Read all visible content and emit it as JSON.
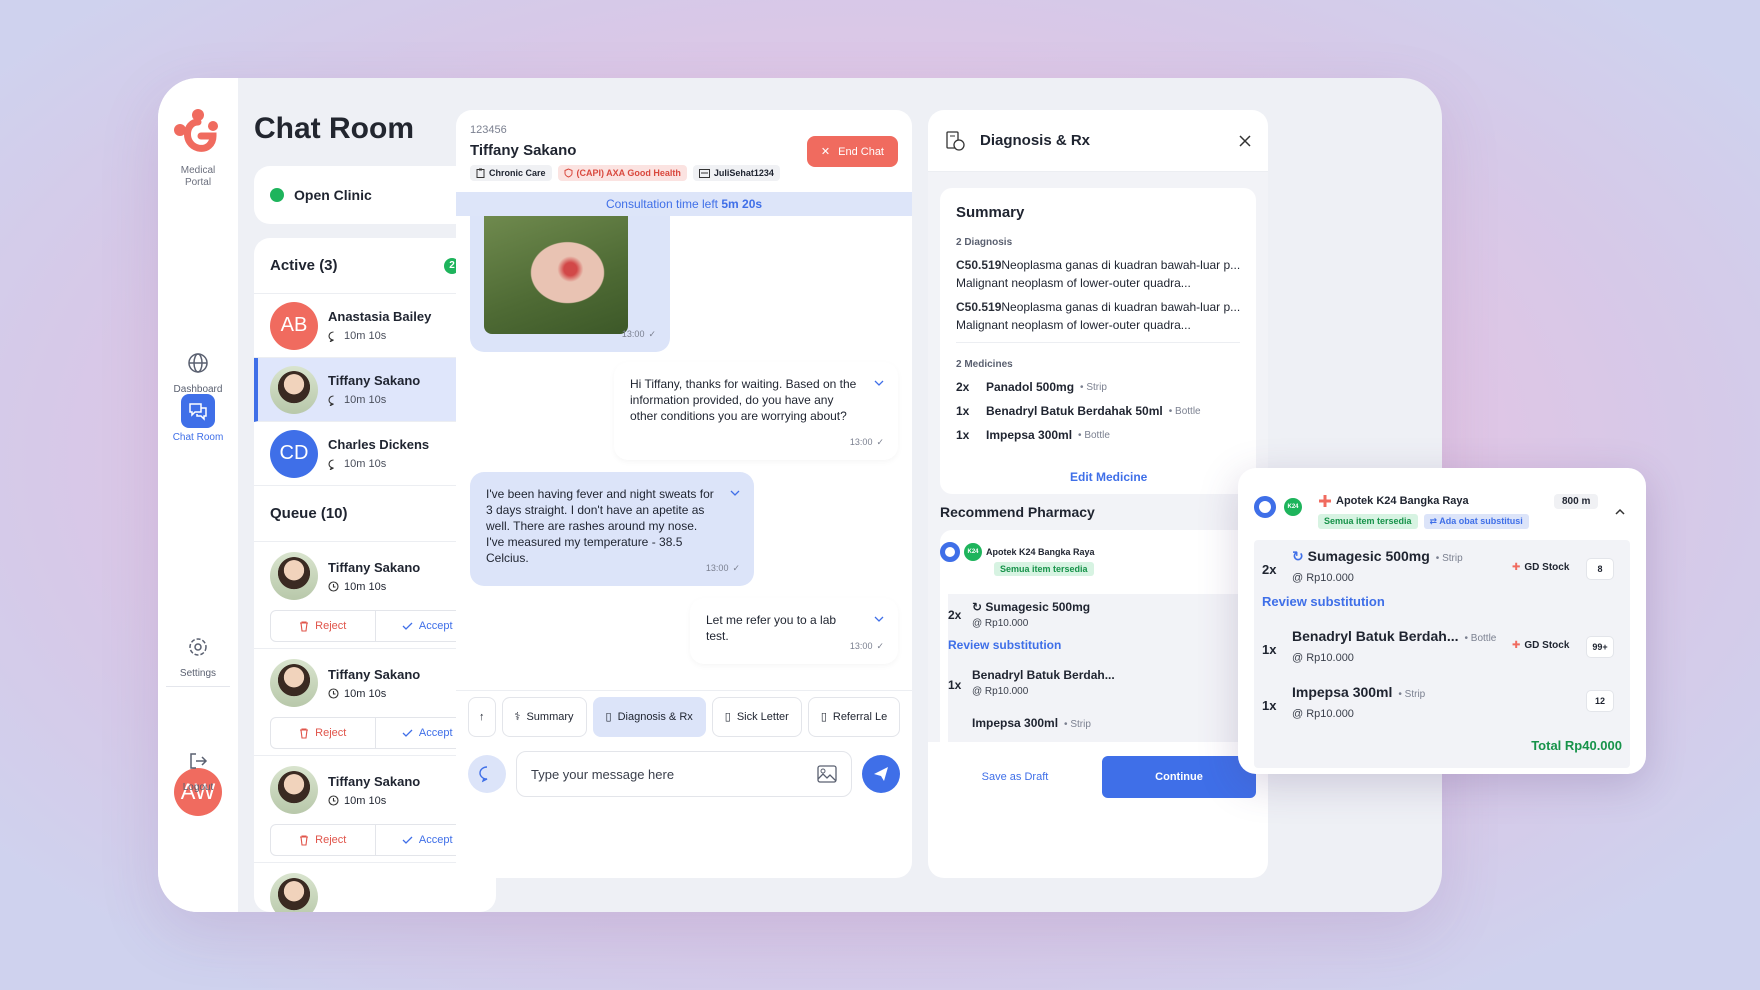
{
  "app": {
    "logo_text": "Medical Portal"
  },
  "nav": {
    "dashboard": "Dashboard",
    "chat_room": "Chat Room",
    "settings": "Settings",
    "logout": "Logout",
    "user_initials": "AW"
  },
  "page": {
    "title": "Chat Room"
  },
  "clinic_select": {
    "value": "Open Clinic"
  },
  "active": {
    "header": "Active (3)",
    "badge": "2",
    "patients": [
      {
        "initials": "AB",
        "name": "Anastasia Bailey",
        "time": "10m 10s",
        "color": "#f06b5f"
      },
      {
        "initials": "",
        "name": "Tiffany Sakano",
        "time": "10m 10s"
      },
      {
        "initials": "CD",
        "name": "Charles Dickens",
        "time": "10m 10s",
        "color": "#3f6fe8"
      }
    ]
  },
  "queue": {
    "header": "Queue (10)",
    "reject": "Reject",
    "accept": "Accept",
    "items": [
      {
        "name": "Tiffany Sakano",
        "time": "10m 10s"
      },
      {
        "name": "Tiffany Sakano",
        "time": "10m 10s"
      },
      {
        "name": "Tiffany Sakano",
        "time": "10m 10s"
      }
    ]
  },
  "chat": {
    "patient_id": "123456",
    "patient_name": "Tiffany Sakano",
    "tags": [
      "Chronic Care",
      "(CAPI) AXA Good Health",
      "JuliSehat1234"
    ],
    "end_chat": "End Chat",
    "consult_prefix": "Consultation time left",
    "consult_time": "5m 20s",
    "messages": [
      {
        "text": "",
        "time": "13:00"
      },
      {
        "text": "Hi Tiffany, thanks for waiting. Based on the information provided, do you have any other conditions you are worrying about?",
        "time": "13:00"
      },
      {
        "text": "I've been having fever and night sweats for 3 days straight. I don't have an apetite as well. There are rashes around my nose. I've measured my temperature - 38.5 Celcius.",
        "time": "13:00"
      },
      {
        "text": "Let me refer you to a lab test.",
        "time": "13:00"
      }
    ],
    "tabs": [
      "Summary",
      "Diagnosis & Rx",
      "Sick Letter",
      "Referral Le"
    ],
    "input_placeholder": "Type your message here"
  },
  "diagnosis": {
    "title": "Diagnosis & Rx",
    "summary_title": "Summary",
    "diag_count": "2 Diagnosis",
    "diagnoses": [
      {
        "code": "C50.519",
        "id": "Neoplasma ganas di kuadran bawah-luar p...",
        "en": "Malignant neoplasm of lower-outer quadra..."
      },
      {
        "code": "C50.519",
        "id": "Neoplasma ganas di kuadran bawah-luar p...",
        "en": "Malignant neoplasm of lower-outer quadra..."
      }
    ],
    "med_count": "2 Medicines",
    "medicines": [
      {
        "qty": "2x",
        "name": "Panadol 500mg",
        "unit": "Strip"
      },
      {
        "qty": "1x",
        "name": "Benadryl Batuk Berdahak 50ml",
        "unit": "Bottle"
      },
      {
        "qty": "1x",
        "name": "Impepsa 300ml",
        "unit": "Bottle"
      }
    ],
    "edit_med": "Edit Medicine",
    "recommend": "Recommend Pharmacy",
    "save_draft": "Save as Draft",
    "continue": "Continue"
  },
  "pharmacy": {
    "name": "Apotek K24 Bangka Raya",
    "distance": "800 m",
    "chip_all": "Semua item tersedia",
    "chip_sub": "Ada obat substitusi",
    "review": "Review substitution",
    "stock_label": "GD Stock",
    "items": [
      {
        "qty": "2x",
        "name": "Sumagesic 500mg",
        "unit": "Strip",
        "price": "@ Rp10.000",
        "stock": "8"
      },
      {
        "qty": "1x",
        "name": "Benadryl Batuk Berdah...",
        "unit": "Bottle",
        "price": "@ Rp10.000",
        "stock": "99+"
      },
      {
        "qty": "1x",
        "name": "Impepsa 300ml",
        "unit": "Strip",
        "price": "@ Rp10.000",
        "stock": "12"
      }
    ],
    "total": "Total Rp40.000",
    "k24_logo": "K24"
  }
}
